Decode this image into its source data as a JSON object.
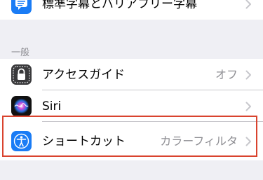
{
  "rows": {
    "captions": {
      "label": "標準字幕とバリアフリー字幕"
    },
    "guided_access": {
      "label": "アクセスガイド",
      "value": "オフ"
    },
    "siri": {
      "label": "Siri"
    },
    "shortcut": {
      "label": "ショートカット",
      "value": "カラーフィルタ"
    }
  },
  "section": {
    "general_header": "一般"
  },
  "colors": {
    "background": "#efeff4",
    "highlight": "#d9432e",
    "guided_access_icon": "#3a3a3c",
    "shortcut_icon": "#1a7cf5",
    "captions_icon": "#1a7cf5"
  },
  "icons": {
    "captions": "speech-bubble-icon",
    "guided_access": "lock-icon",
    "siri": "siri-icon",
    "shortcut": "accessibility-person-icon",
    "chevron": "chevron-right-icon"
  }
}
